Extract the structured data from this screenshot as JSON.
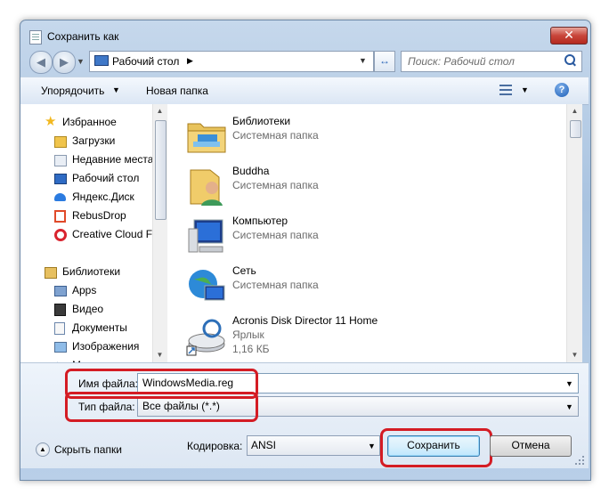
{
  "window": {
    "title": "Сохранить как",
    "close_glyph": "✕"
  },
  "nav": {
    "back_glyph": "◀",
    "forward_glyph": "▶",
    "address": "Рабочий стол",
    "address_sep": "▶",
    "dropdown_glyph": "▼",
    "refresh_glyph": "↔",
    "search_placeholder": "Поиск: Рабочий стол"
  },
  "toolbar": {
    "organize": "Упорядочить",
    "organize_caret": "▼",
    "new_folder": "Новая папка",
    "view_caret": "▼",
    "help": "?"
  },
  "sidebar": {
    "items": [
      {
        "label": "Избранное",
        "icon": "star-icon",
        "color": "#f2b820"
      },
      {
        "label": "Загрузки",
        "icon": "downloads-icon",
        "color": "#3b7bd3"
      },
      {
        "label": "Недавние места",
        "icon": "recent-icon",
        "color": "#8a9ab0"
      },
      {
        "label": "Рабочий стол",
        "icon": "desktop-icon",
        "color": "#2f6bc4"
      },
      {
        "label": "Яндекс.Диск",
        "icon": "yandex-disk-icon",
        "color": "#2b7be0"
      },
      {
        "label": "RebusDrop",
        "icon": "rebusdrop-icon",
        "color": "#e04a2a"
      },
      {
        "label": "Creative Cloud Fi",
        "icon": "creative-cloud-icon",
        "color": "#d9242f"
      },
      {
        "label": "Библиотеки",
        "icon": "libraries-icon",
        "color": "#d9a93a"
      },
      {
        "label": "Apps",
        "icon": "apps-icon",
        "color": "#5a7fb2"
      },
      {
        "label": "Видео",
        "icon": "video-icon",
        "color": "#3a3a3a"
      },
      {
        "label": "Документы",
        "icon": "documents-icon",
        "color": "#6b86ab"
      },
      {
        "label": "Изображения",
        "icon": "images-icon",
        "color": "#4f88c6"
      },
      {
        "label": "М",
        "icon": "music-icon",
        "color": "#3d6db0"
      }
    ]
  },
  "files": [
    {
      "name": "Библиотеки",
      "type": "Системная папка",
      "size": "",
      "icon": "libraries-folder-icon"
    },
    {
      "name": "Buddha",
      "type": "Системная папка",
      "size": "",
      "icon": "user-folder-icon"
    },
    {
      "name": "Компьютер",
      "type": "Системная папка",
      "size": "",
      "icon": "computer-icon"
    },
    {
      "name": "Сеть",
      "type": "Системная папка",
      "size": "",
      "icon": "network-icon"
    },
    {
      "name": "Acronis Disk Director 11 Home",
      "type": "Ярлык",
      "size": "1,16 КБ",
      "icon": "acronis-shortcut-icon"
    }
  ],
  "form": {
    "filename_label": "Имя файла:",
    "filename_value": "WindowsMedia.reg",
    "filetype_label": "Тип файла:",
    "filetype_value": "Все файлы  (*.*)",
    "dropdown_glyph": "▼"
  },
  "footer": {
    "hide_folders": "Скрыть папки",
    "hide_glyph": "▲",
    "encoding_label": "Кодировка:",
    "encoding_value": "ANSI",
    "save": "Сохранить",
    "cancel": "Отмена"
  },
  "colors": {
    "highlight": "#d41c24",
    "accent": "#3c7fb1"
  }
}
